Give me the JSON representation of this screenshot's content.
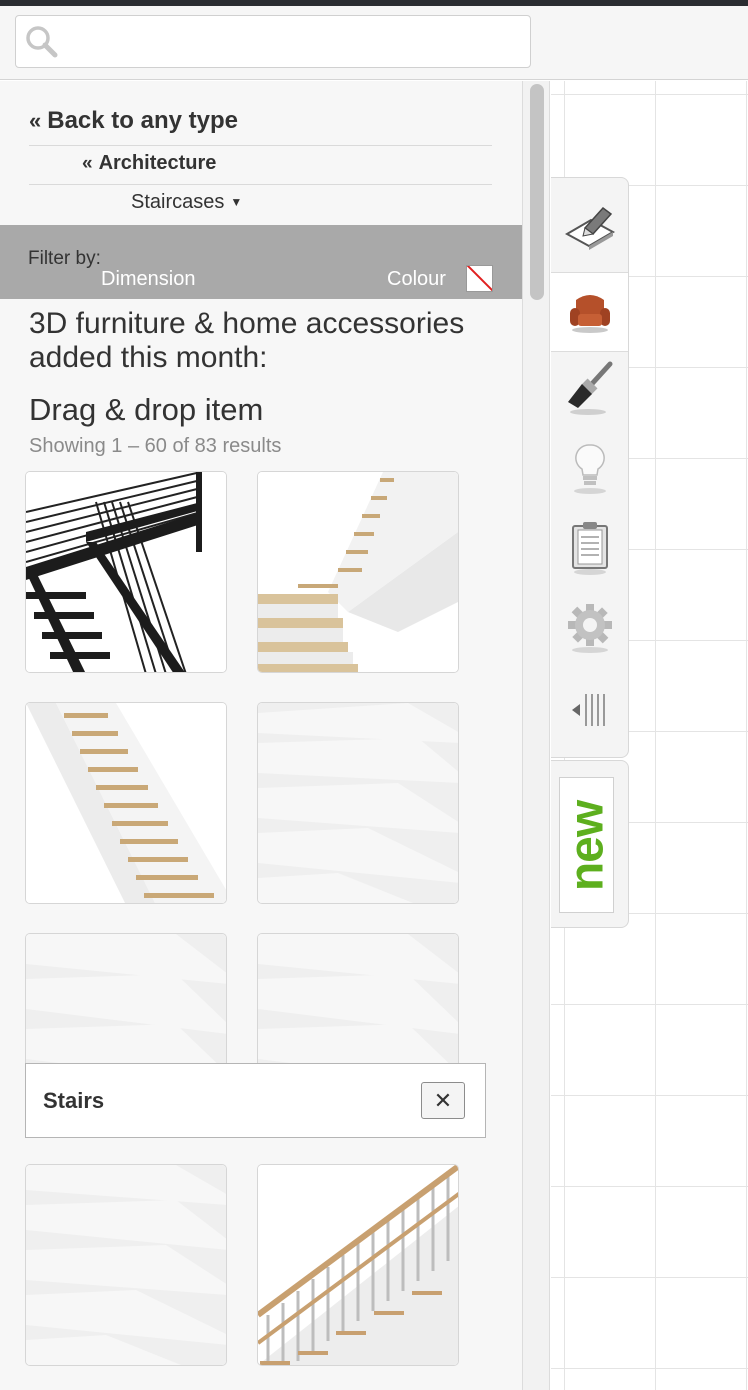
{
  "search": {
    "value": "",
    "placeholder": "",
    "icon": "search-icon"
  },
  "nav": {
    "back_label": "Back to any type",
    "back_chevron": "«",
    "category_label": "Architecture",
    "category_chevron": "«",
    "subcategory_label": "Staircases",
    "subcategory_arrow": "▼"
  },
  "filter": {
    "label": "Filter by:",
    "dimension_label": "Dimension",
    "colour_label": "Colour"
  },
  "content": {
    "headline": "3D furniture & home accessories added this month:",
    "subheading": "Drag & drop item",
    "results_text": "Showing 1 – 60 of 83 results"
  },
  "items": [
    {
      "name": "metal-staircase",
      "style": "metal"
    },
    {
      "name": "l-shaped-wood-staircase",
      "style": "wood-l"
    },
    {
      "name": "straight-wood-staircase",
      "style": "wood-straight"
    },
    {
      "name": "white-stairs",
      "style": "white"
    },
    {
      "name": "white-stairs",
      "style": "white"
    },
    {
      "name": "white-stairs",
      "style": "white"
    },
    {
      "name": "white-stairs",
      "style": "white"
    },
    {
      "name": "staircase-with-railing",
      "style": "railing"
    }
  ],
  "popup": {
    "title": "Stairs",
    "close_label": "✕"
  },
  "toolbar": {
    "tools": [
      {
        "icon": "eraser-pencil-icon",
        "active": false
      },
      {
        "icon": "armchair-icon",
        "active": true
      },
      {
        "icon": "paint-brush-icon",
        "active": false
      },
      {
        "icon": "light-bulb-icon",
        "active": false
      },
      {
        "icon": "clipboard-icon",
        "active": false
      },
      {
        "icon": "gear-icon",
        "active": false
      },
      {
        "icon": "collapse-panel-icon",
        "active": false
      }
    ],
    "new_label": "new"
  },
  "colors": {
    "accent_green": "#5daf1e",
    "filter_bar": "#a9a9a9",
    "armchair": "#b5502a"
  }
}
